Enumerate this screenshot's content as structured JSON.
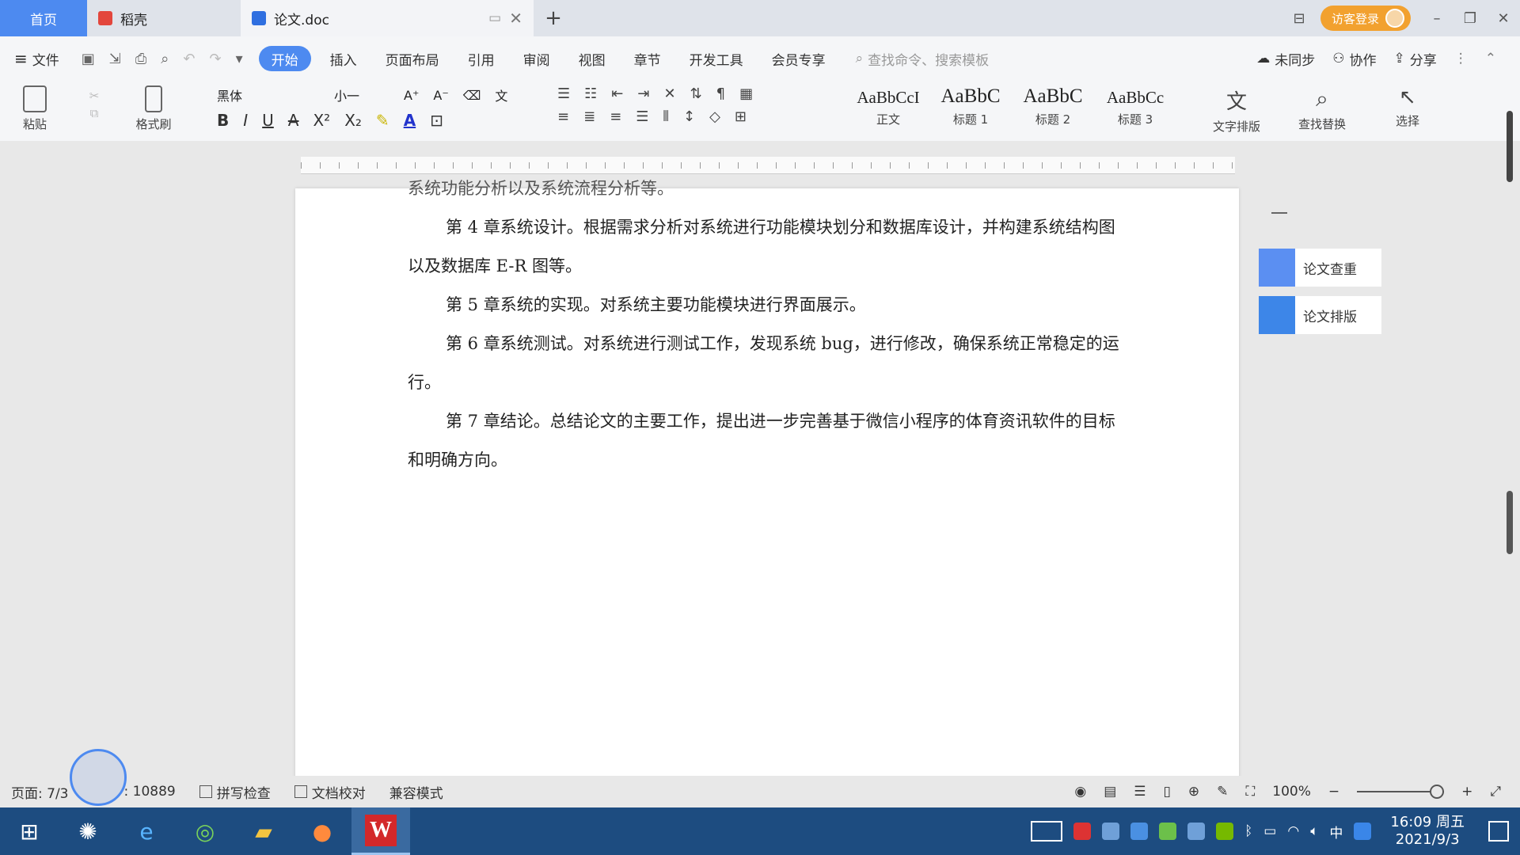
{
  "tabs": {
    "home": "首页",
    "daoke": "稻壳",
    "doc": "论文.doc",
    "login": "访客登录"
  },
  "menu": {
    "file": "文件",
    "items": [
      "开始",
      "插入",
      "页面布局",
      "引用",
      "审阅",
      "视图",
      "章节",
      "开发工具",
      "会员专享"
    ],
    "search_placeholder": "查找命令、搜索模板",
    "sync": "未同步",
    "collab": "协作",
    "share": "分享"
  },
  "ribbon": {
    "paste": "粘贴",
    "format_painter": "格式刷",
    "font_name": "黑体",
    "font_size": "小一",
    "styles": [
      {
        "sample": "AaBbCcI",
        "name": "正文"
      },
      {
        "sample": "AaBbC",
        "name": "标题 1"
      },
      {
        "sample": "AaBbC",
        "name": "标题 2"
      },
      {
        "sample": "AaBbCc",
        "name": "标题 3"
      }
    ],
    "text_tools": "文字排版",
    "find_replace": "查找替换",
    "select": "选择"
  },
  "document": {
    "paragraphs": [
      {
        "text": "系统功能分析以及系统流程分析等。",
        "indent": false,
        "cut": true
      },
      {
        "text": "第 4 章系统设计。根据需求分析对系统进行功能模块划分和数据库设计，并构建系统结构图以及数据库 E-R 图等。",
        "indent": true
      },
      {
        "text": "第 5 章系统的实现。对系统主要功能模块进行界面展示。",
        "indent": true
      },
      {
        "text": "第 6 章系统测试。对系统进行测试工作，发现系统 bug，进行修改，确保系统正常稳定的运行。",
        "indent": true
      },
      {
        "text": "第 7 章结论。总结论文的主要工作，提出进一步完善基于微信小程序的体育资讯软件的目标和明确方向。",
        "indent": true
      }
    ]
  },
  "side_panel": {
    "check": "论文查重",
    "layout": "论文排版"
  },
  "status": {
    "page": "页面: 7/3",
    "words": ": 10889",
    "spell": "拼写检查",
    "proof": "文档校对",
    "compat": "兼容模式",
    "zoom": "100%"
  },
  "taskbar": {
    "time": "16:09 周五",
    "date": "2021/9/3",
    "ime": "中",
    "wps_letter": "W"
  },
  "colors": {
    "accent": "#4d8af0",
    "taskbar": "#1d4c80",
    "login": "#f2a12f"
  }
}
